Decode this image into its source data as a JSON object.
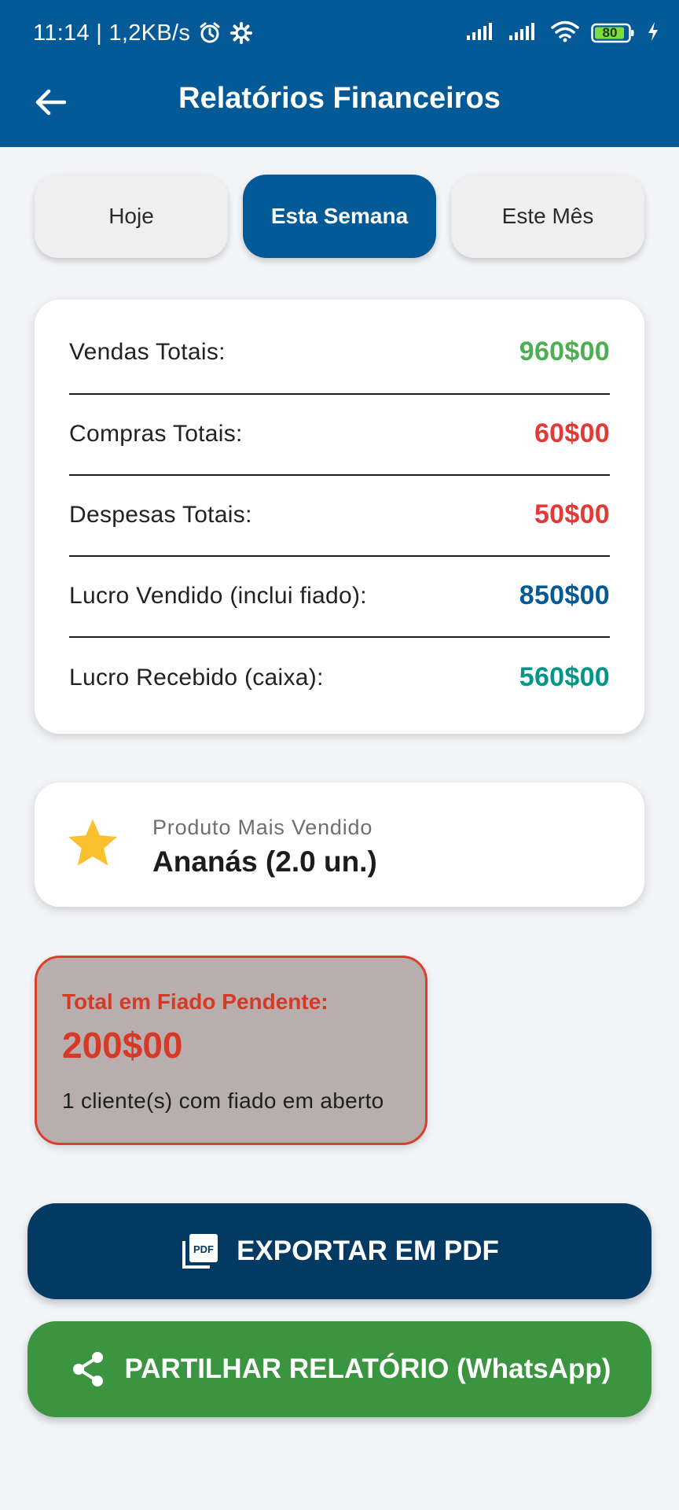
{
  "statusbar": {
    "time_speed": "11:14 | 1,2KB/s",
    "battery": "80"
  },
  "header": {
    "title": "Relatórios Financeiros"
  },
  "tabs": [
    {
      "label": "Hoje",
      "active": false
    },
    {
      "label": "Esta Semana",
      "active": true
    },
    {
      "label": "Este Mês",
      "active": false
    }
  ],
  "summary": {
    "rows": [
      {
        "label": "Vendas Totais:",
        "value": "960$00",
        "color": "#4caf50"
      },
      {
        "label": "Compras Totais:",
        "value": "60$00",
        "color": "#e53935"
      },
      {
        "label": "Despesas Totais:",
        "value": "50$00",
        "color": "#e53935"
      },
      {
        "label": "Lucro Vendido (inclui fiado):",
        "value": "850$00",
        "color": "#035a97"
      },
      {
        "label": "Lucro Recebido (caixa):",
        "value": "560$00",
        "color": "#009688"
      }
    ]
  },
  "top_product": {
    "label": "Produto Mais Vendido",
    "value": "Ananás (2.0 un.)",
    "icon": "star-icon",
    "icon_color": "#fbc02d"
  },
  "fiado": {
    "title": "Total em Fiado Pendente:",
    "amount": "200$00",
    "subtitle": "1 cliente(s) com fiado em aberto"
  },
  "buttons": {
    "export_pdf": "EXPORTAR EM PDF",
    "share": "PARTILHAR RELATÓRIO (WhatsApp)"
  }
}
